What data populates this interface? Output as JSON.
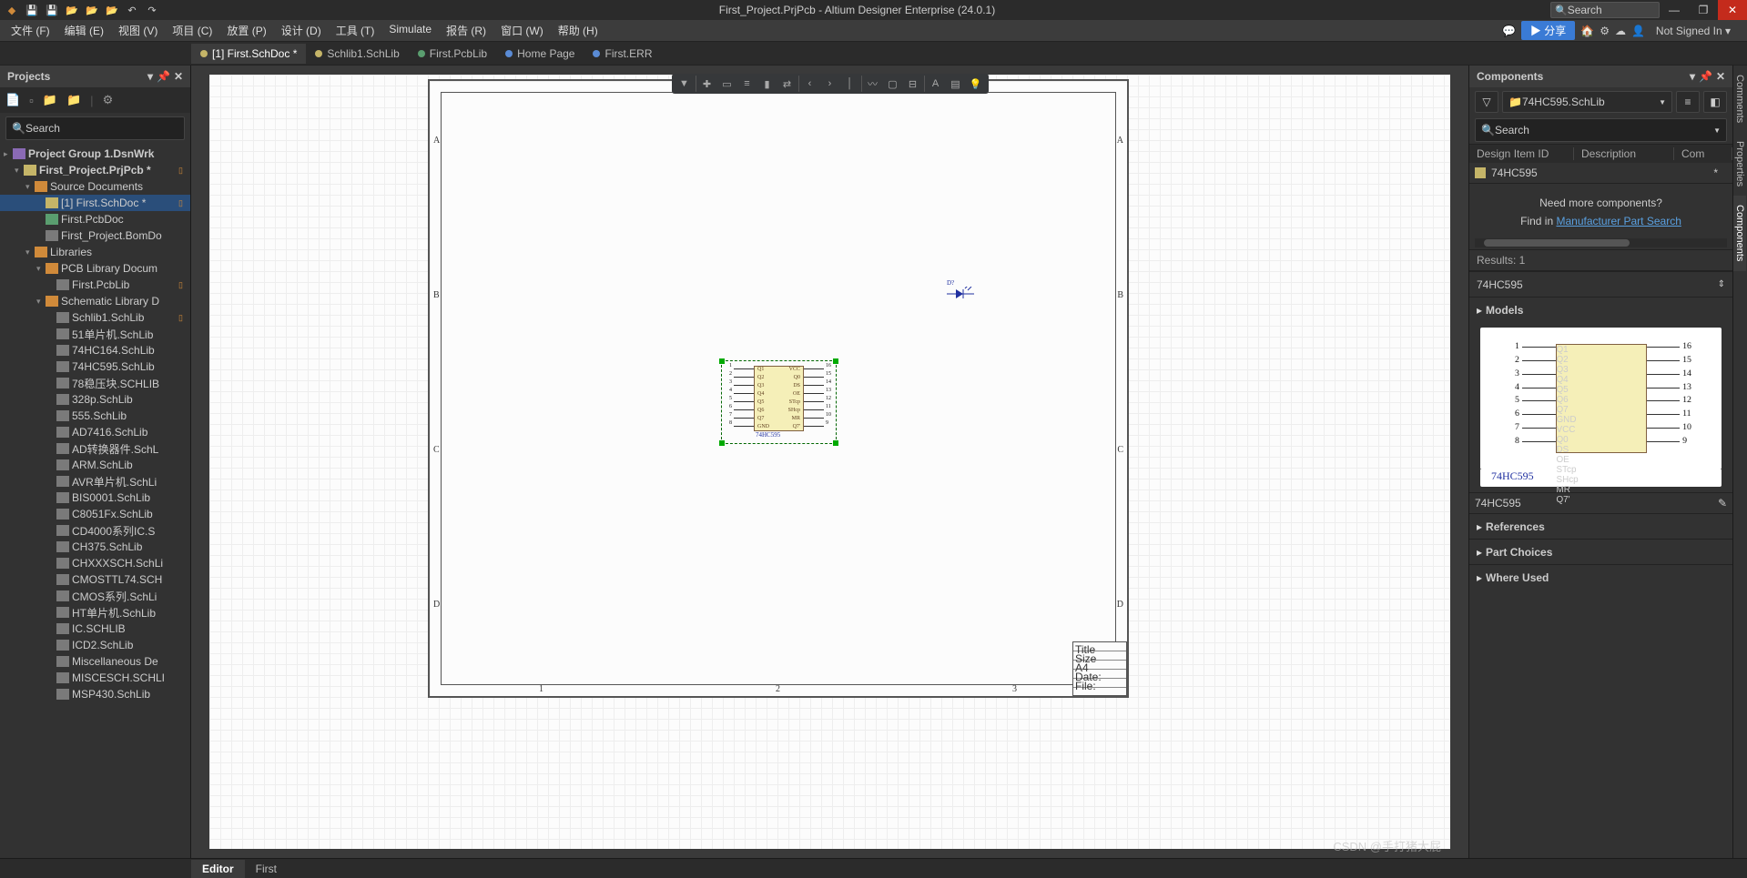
{
  "title": "First_Project.PrjPcb - Altium Designer Enterprise (24.0.1)",
  "titlebar_search": "Search",
  "menu": [
    "文件 (F)",
    "编辑 (E)",
    "视图 (V)",
    "项目 (C)",
    "放置 (P)",
    "设计 (D)",
    "工具 (T)",
    "Simulate",
    "报告 (R)",
    "窗口 (W)",
    "帮助 (H)"
  ],
  "share_btn": "▶ 分享",
  "signin": "Not Signed In ▾",
  "tabs": [
    {
      "label": "[1] First.SchDoc *",
      "active": true,
      "dot": "yel"
    },
    {
      "label": "Schlib1.SchLib",
      "dot": "yel"
    },
    {
      "label": "First.PcbLib",
      "dot": "grn"
    },
    {
      "label": "Home Page",
      "dot": "blu"
    },
    {
      "label": "First.ERR",
      "dot": "blu"
    }
  ],
  "projects_panel": {
    "title": "Projects",
    "search": "Search",
    "tree": [
      {
        "d": 0,
        "c": "▸",
        "i": "i-grp",
        "t": "Project Group 1.DsnWrk",
        "bold": true
      },
      {
        "d": 1,
        "c": "▾",
        "i": "i-prj",
        "t": "First_Project.PrjPcb *",
        "m": "▯",
        "bold": true
      },
      {
        "d": 2,
        "c": "▾",
        "i": "i-fld",
        "t": "Source Documents"
      },
      {
        "d": 3,
        "c": "",
        "i": "i-sch",
        "t": "[1] First.SchDoc *",
        "m": "▯",
        "sel": true
      },
      {
        "d": 3,
        "c": "",
        "i": "i-pcb",
        "t": "First.PcbDoc"
      },
      {
        "d": 3,
        "c": "",
        "i": "i-lib",
        "t": "First_Project.BomDo"
      },
      {
        "d": 2,
        "c": "▾",
        "i": "i-fld",
        "t": "Libraries"
      },
      {
        "d": 3,
        "c": "▾",
        "i": "i-fld",
        "t": "PCB Library Docum"
      },
      {
        "d": 4,
        "c": "",
        "i": "i-lib",
        "t": "First.PcbLib",
        "m": "▯"
      },
      {
        "d": 3,
        "c": "▾",
        "i": "i-fld",
        "t": "Schematic Library D"
      },
      {
        "d": 4,
        "c": "",
        "i": "i-lib",
        "t": "Schlib1.SchLib",
        "m": "▯"
      },
      {
        "d": 4,
        "c": "",
        "i": "i-lib",
        "t": "51单片机.SchLib"
      },
      {
        "d": 4,
        "c": "",
        "i": "i-lib",
        "t": "74HC164.SchLib"
      },
      {
        "d": 4,
        "c": "",
        "i": "i-lib",
        "t": "74HC595.SchLib"
      },
      {
        "d": 4,
        "c": "",
        "i": "i-lib",
        "t": "78稳压块.SCHLIB"
      },
      {
        "d": 4,
        "c": "",
        "i": "i-lib",
        "t": "328p.SchLib"
      },
      {
        "d": 4,
        "c": "",
        "i": "i-lib",
        "t": "555.SchLib"
      },
      {
        "d": 4,
        "c": "",
        "i": "i-lib",
        "t": "AD7416.SchLib"
      },
      {
        "d": 4,
        "c": "",
        "i": "i-lib",
        "t": "AD转换器件.SchL"
      },
      {
        "d": 4,
        "c": "",
        "i": "i-lib",
        "t": "ARM.SchLib"
      },
      {
        "d": 4,
        "c": "",
        "i": "i-lib",
        "t": "AVR单片机.SchLi"
      },
      {
        "d": 4,
        "c": "",
        "i": "i-lib",
        "t": "BIS0001.SchLib"
      },
      {
        "d": 4,
        "c": "",
        "i": "i-lib",
        "t": "C8051Fx.SchLib"
      },
      {
        "d": 4,
        "c": "",
        "i": "i-lib",
        "t": "CD4000系列IC.S"
      },
      {
        "d": 4,
        "c": "",
        "i": "i-lib",
        "t": "CH375.SchLib"
      },
      {
        "d": 4,
        "c": "",
        "i": "i-lib",
        "t": "CHXXXSCH.SchLi"
      },
      {
        "d": 4,
        "c": "",
        "i": "i-lib",
        "t": "CMOSTTL74.SCH"
      },
      {
        "d": 4,
        "c": "",
        "i": "i-lib",
        "t": "CMOS系列.SchLi"
      },
      {
        "d": 4,
        "c": "",
        "i": "i-lib",
        "t": "HT单片机.SchLib"
      },
      {
        "d": 4,
        "c": "",
        "i": "i-lib",
        "t": "IC.SCHLIB"
      },
      {
        "d": 4,
        "c": "",
        "i": "i-lib",
        "t": "ICD2.SchLib"
      },
      {
        "d": 4,
        "c": "",
        "i": "i-lib",
        "t": "Miscellaneous De"
      },
      {
        "d": 4,
        "c": "",
        "i": "i-lib",
        "t": "MISCESCH.SCHLI"
      },
      {
        "d": 4,
        "c": "",
        "i": "i-lib",
        "t": "MSP430.SchLib"
      }
    ]
  },
  "active_bar_icons": [
    "filter",
    "cross",
    "rect",
    "align-l",
    "bar",
    "swap",
    "chev-l",
    "chev-r",
    "line",
    "wave",
    "tag",
    "dash",
    "text",
    "note",
    "bulb"
  ],
  "chip": {
    "name": "74HC595",
    "left_pins": [
      [
        "1",
        "Q1"
      ],
      [
        "2",
        "Q2"
      ],
      [
        "3",
        "Q3"
      ],
      [
        "4",
        "Q4"
      ],
      [
        "5",
        "Q5"
      ],
      [
        "6",
        "Q6"
      ],
      [
        "7",
        "Q7"
      ],
      [
        "8",
        "GND"
      ]
    ],
    "right_pins": [
      [
        "16",
        "VCC"
      ],
      [
        "15",
        "Q0"
      ],
      [
        "14",
        "DS"
      ],
      [
        "13",
        "OE"
      ],
      [
        "12",
        "STcp"
      ],
      [
        "11",
        "SHcp"
      ],
      [
        "10",
        "MR"
      ],
      [
        "9",
        "Q7'"
      ]
    ]
  },
  "diode_label": "D?",
  "zones_v": [
    "A",
    "B",
    "C",
    "D"
  ],
  "zones_h": [
    "1",
    "2",
    "3"
  ],
  "title_block": {
    "r1": "Title",
    "r2": "Size",
    "r3": "A4",
    "r4": "Date:",
    "r5": "File:"
  },
  "components_panel": {
    "title": "Components",
    "lib": "74HC595.SchLib",
    "search": "Search",
    "cols": [
      "Design Item ID",
      "Description",
      "Com"
    ],
    "row": "74HC595",
    "need": "Need more components?",
    "find": "Find in ",
    "mps": "Manufacturer Part Search",
    "results": "Results: 1",
    "selected": "74HC595",
    "models": "Models",
    "model_name": "74HC595",
    "footprint_name": "74HC595",
    "refs": "References",
    "parts": "Part Choices",
    "where": "Where Used"
  },
  "rail_tabs": [
    "Comments",
    "Properties",
    "Components"
  ],
  "footer": {
    "tabs": [
      "Editor",
      "First"
    ]
  },
  "watermark": "CSDN @手打猪大屁"
}
